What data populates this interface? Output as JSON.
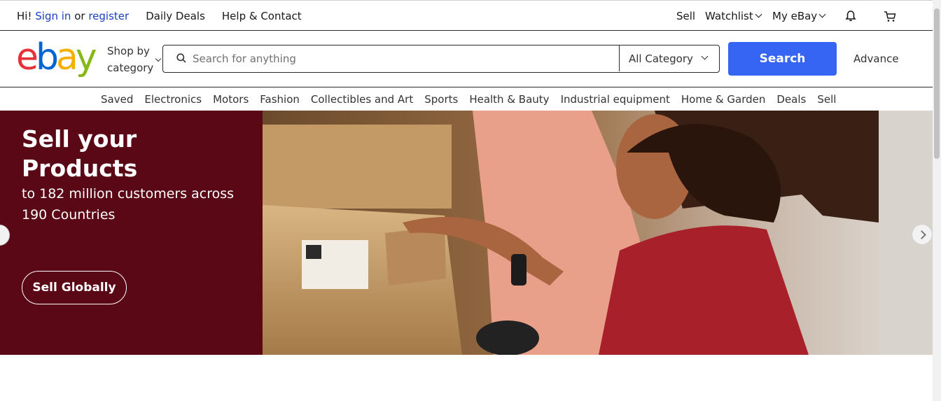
{
  "topbar": {
    "greeting": "Hi!",
    "sign_in": "Sign in",
    "or": "or",
    "register": "register",
    "daily_deals": "Daily Deals",
    "help_contact": "Help & Contact",
    "sell": "Sell",
    "watchlist": "Watchlist",
    "my_ebay": "My eBay",
    "notification_icon": "bell-icon",
    "cart_icon": "cart-icon"
  },
  "header": {
    "logo_letters": [
      "e",
      "b",
      "a",
      "y"
    ],
    "logo_colors": [
      "#e53238",
      "#0064d2",
      "#f5af02",
      "#86b817"
    ],
    "shop_by_line1": "Shop by",
    "shop_by_line2": "category",
    "search_placeholder": "Search for anything",
    "category_selected": "All Category",
    "search_button": "Search",
    "advance_link": "Advance",
    "accent_color": "#3665f3"
  },
  "categories": [
    "Saved",
    "Electronics",
    "Motors",
    "Fashion",
    "Collectibles and Art",
    "Sports",
    "Health & Bauty",
    "Industrial equipment",
    "Home & Garden",
    "Deals",
    "Sell"
  ],
  "hero": {
    "title_line1": "Sell your",
    "title_line2": "Products",
    "subtitle": "to 182 million customers across 190 Countries",
    "cta": "Sell Globally",
    "panel_color": "#5a0716"
  }
}
